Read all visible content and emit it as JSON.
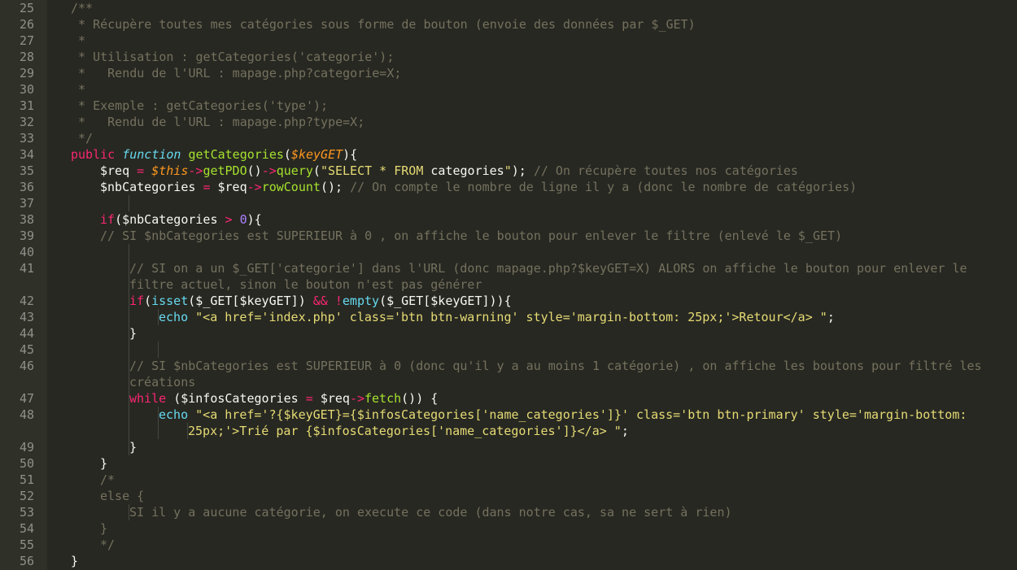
{
  "colors": {
    "background": "#272822",
    "gutter": "#2F3129",
    "line_number": "#90908A",
    "comment": "#75715E",
    "keyword": "#F92672",
    "string": "#E6DB74",
    "function": "#A6E22E",
    "storage": "#66D9EF",
    "parameter": "#FD971F",
    "number": "#AE81FF",
    "text": "#F8F8F2"
  },
  "lines": [
    {
      "num": "25",
      "indent": 1,
      "tokens": [
        [
          "/**",
          "c"
        ]
      ]
    },
    {
      "num": "26",
      "indent": 1,
      "tokens": [
        [
          " * Récupère toutes mes catégories sous forme de bouton (envoie des données par $_GET)",
          "c"
        ]
      ]
    },
    {
      "num": "27",
      "indent": 1,
      "tokens": [
        [
          " *",
          "c"
        ]
      ]
    },
    {
      "num": "28",
      "indent": 1,
      "tokens": [
        [
          " * Utilisation : getCategories('categorie');",
          "c"
        ]
      ]
    },
    {
      "num": "29",
      "indent": 1,
      "tokens": [
        [
          " *   Rendu de l'URL : mapage.php?categorie=X;",
          "c"
        ]
      ]
    },
    {
      "num": "30",
      "indent": 1,
      "tokens": [
        [
          " *",
          "c"
        ]
      ]
    },
    {
      "num": "31",
      "indent": 1,
      "tokens": [
        [
          " * Exemple : getCategories('type');",
          "c"
        ]
      ]
    },
    {
      "num": "32",
      "indent": 1,
      "tokens": [
        [
          " *   Rendu de l'URL : mapage.php?type=X;",
          "c"
        ]
      ]
    },
    {
      "num": "33",
      "indent": 1,
      "tokens": [
        [
          " */",
          "c"
        ]
      ]
    },
    {
      "num": "34",
      "indent": 1,
      "tokens": [
        [
          "public ",
          "k"
        ],
        [
          "function ",
          "st"
        ],
        [
          "getCategories",
          "f"
        ],
        [
          "(",
          "v"
        ],
        [
          "$keyGET",
          "p"
        ],
        [
          "){",
          "v"
        ]
      ]
    },
    {
      "num": "35",
      "indent": 2,
      "tokens": [
        [
          "$req ",
          "v"
        ],
        [
          "= ",
          "k"
        ],
        [
          "$this",
          "p"
        ],
        [
          "->",
          "k"
        ],
        [
          "getPDO",
          "f"
        ],
        [
          "()",
          "v"
        ],
        [
          "->",
          "k"
        ],
        [
          "query",
          "f"
        ],
        [
          "(",
          "v"
        ],
        [
          "\"SELECT * FROM ",
          "s"
        ],
        [
          "categories",
          "v"
        ],
        [
          "\"",
          "s"
        ],
        [
          "); ",
          "v"
        ],
        [
          "// On récupère toutes nos catégories",
          "c"
        ]
      ]
    },
    {
      "num": "36",
      "indent": 2,
      "tokens": [
        [
          "$nbCategories ",
          "v"
        ],
        [
          "= ",
          "k"
        ],
        [
          "$req",
          "v"
        ],
        [
          "->",
          "k"
        ],
        [
          "rowCount",
          "f"
        ],
        [
          "(); ",
          "v"
        ],
        [
          "// On compte le nombre de ligne il y a (donc le nombre de catégories)",
          "c"
        ]
      ]
    },
    {
      "num": "37",
      "indent": 2,
      "tokens": []
    },
    {
      "num": "38",
      "indent": 2,
      "tokens": [
        [
          "if",
          "k"
        ],
        [
          "($nbCategories ",
          "v"
        ],
        [
          "> ",
          "k"
        ],
        [
          "0",
          "n"
        ],
        [
          "){",
          "v"
        ]
      ]
    },
    {
      "num": "39",
      "indent": 2,
      "tokens": [
        [
          "// SI $nbCategories est SUPERIEUR à 0 , on affiche le bouton pour enlever le filtre (enlevé le $_GET)",
          "c"
        ]
      ]
    },
    {
      "num": "40",
      "indent": 2,
      "tokens": []
    },
    {
      "num": "41",
      "indent": 3,
      "tokens": [
        [
          "// SI on a un $_GET['categorie'] dans l'URL (donc mapage.php?$keyGET=X) ALORS on affiche le bouton pour enlever le",
          "c"
        ]
      ]
    },
    {
      "num": "",
      "indent": 3,
      "tokens": [
        [
          "filtre actuel, sinon le bouton n'est pas générer",
          "c"
        ]
      ]
    },
    {
      "num": "42",
      "indent": 3,
      "tokens": [
        [
          "if",
          "k"
        ],
        [
          "(",
          "v"
        ],
        [
          "isset",
          "kw"
        ],
        [
          "($_GET[$keyGET]) ",
          "v"
        ],
        [
          "&& ",
          "k"
        ],
        [
          "!",
          "k"
        ],
        [
          "empty",
          "kw"
        ],
        [
          "($_GET[$keyGET])){",
          "v"
        ]
      ]
    },
    {
      "num": "43",
      "indent": 4,
      "tokens": [
        [
          "echo ",
          "kw"
        ],
        [
          "\"<a href='index.php' class='btn btn-warning' style='margin-bottom: 25px;'>Retour</a> \"",
          "s"
        ],
        [
          ";",
          "v"
        ]
      ]
    },
    {
      "num": "44",
      "indent": 3,
      "tokens": [
        [
          "}",
          "v"
        ]
      ]
    },
    {
      "num": "45",
      "indent": 3,
      "tokens": []
    },
    {
      "num": "46",
      "indent": 3,
      "tokens": [
        [
          "// SI $nbCategories est SUPERIEUR à 0 (donc qu'il y a au moins 1 catégorie) , on affiche les boutons pour filtré les",
          "c"
        ]
      ]
    },
    {
      "num": "",
      "indent": 3,
      "tokens": [
        [
          "créations",
          "c"
        ]
      ]
    },
    {
      "num": "47",
      "indent": 3,
      "tokens": [
        [
          "while ",
          "k"
        ],
        [
          "($infosCategories ",
          "v"
        ],
        [
          "= ",
          "k"
        ],
        [
          "$req",
          "v"
        ],
        [
          "->",
          "k"
        ],
        [
          "fetch",
          "f"
        ],
        [
          "()) {",
          "v"
        ]
      ]
    },
    {
      "num": "48",
      "indent": 4,
      "tokens": [
        [
          "echo ",
          "kw"
        ],
        [
          "\"<a href='?{$keyGET}={$infosCategories['name_categories']}' class='btn btn-primary' style='margin-bottom:",
          "s"
        ]
      ]
    },
    {
      "num": "",
      "indent": 5,
      "tokens": [
        [
          "25px;'>Trié par {$infosCategories['name_categories']}</a> \"",
          "s"
        ],
        [
          ";",
          "v"
        ]
      ]
    },
    {
      "num": "49",
      "indent": 3,
      "tokens": [
        [
          "}",
          "v"
        ]
      ]
    },
    {
      "num": "50",
      "indent": 2,
      "tokens": [
        [
          "}",
          "v"
        ]
      ]
    },
    {
      "num": "51",
      "indent": 2,
      "tokens": [
        [
          "/*",
          "c"
        ]
      ]
    },
    {
      "num": "52",
      "indent": 2,
      "tokens": [
        [
          "else {",
          "c"
        ]
      ]
    },
    {
      "num": "53",
      "indent": 3,
      "tokens": [
        [
          "SI il y a aucune catégorie, on execute ce code (dans notre cas, sa ne sert à rien)",
          "c"
        ]
      ]
    },
    {
      "num": "54",
      "indent": 2,
      "tokens": [
        [
          "}",
          "c"
        ]
      ]
    },
    {
      "num": "55",
      "indent": 2,
      "tokens": [
        [
          "*/",
          "c"
        ]
      ]
    },
    {
      "num": "56",
      "indent": 1,
      "tokens": [
        [
          "}",
          "v"
        ]
      ]
    }
  ]
}
